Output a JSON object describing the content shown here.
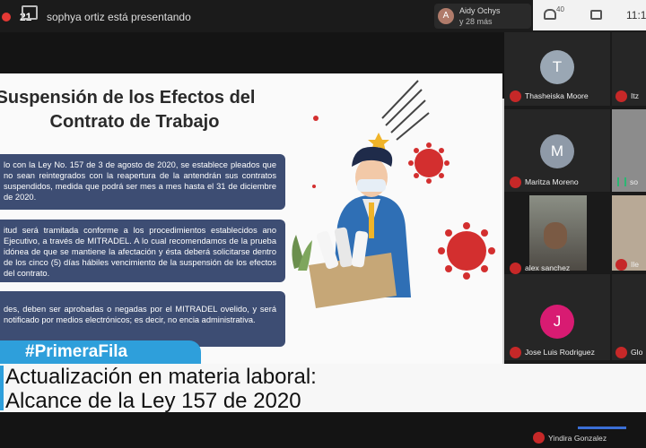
{
  "topbar": {
    "recording_count": "21",
    "presenting_text": "sophya ortiz está presentando",
    "presenter_chip": {
      "avatar_letter": "A",
      "name": "Aidy Ochys",
      "more": "y 28 más"
    },
    "people_count": "40",
    "clock": "11:1"
  },
  "slide": {
    "title_line1": "Suspensión de los Efectos del",
    "title_line2": "Contrato de Trabajo",
    "box1": "lo con la Ley No. 157 de 3 de agosto de 2020, se establece pleados que no sean reintegrados con la reapertura de la antendrán sus contratos suspendidos, medida que podrá ser mes a mes hasta el 31 de diciembre de 2020.",
    "box2": "itud será tramitada conforme a los procedimientos establecidos ano Ejecutivo, a través de MITRADEL. A lo cual recomendamos de la prueba idónea de que se mantiene la afectación y ésta deberá solicitarse dentro de los cinco (5) días hábiles vencimiento de la suspensión de los efectos del contrato.",
    "box3": "des, deben ser aprobadas o negadas por el MITRADEL ovelido, y será notificado por medios electrónicos; es decir, no encia administrativa."
  },
  "participants": [
    {
      "name": "Thasheiska Moore",
      "avatar_letter": "T",
      "avatar_color": "#9aa7b4"
    },
    {
      "name": "Itz",
      "avatar_letter": "",
      "avatar_color": ""
    },
    {
      "name": "Maritza Moreno",
      "avatar_letter": "M",
      "avatar_color": "#8f9aa8"
    },
    {
      "name": "so",
      "avatar_letter": "",
      "avatar_color": ""
    },
    {
      "name": "alex sanchez",
      "avatar_letter": "",
      "avatar_color": ""
    },
    {
      "name": "Ile",
      "avatar_letter": "",
      "avatar_color": ""
    },
    {
      "name": "Jose Luis Rodriguez",
      "avatar_letter": "J",
      "avatar_color": "#d81b72"
    },
    {
      "name": "Glo",
      "avatar_letter": "",
      "avatar_color": ""
    },
    {
      "name": "Yindira Gonzalez",
      "avatar_letter": "",
      "avatar_color": ""
    }
  ],
  "banner": {
    "hashtag": "#PrimeraFila",
    "line1": "Actualización en materia laboral:",
    "line2": "Alcance de la Ley 157 de 2020"
  },
  "colors": {
    "box_bg": "#3d4d73",
    "hashtag_bg": "#2e9fdb",
    "mic_off": "#c62828",
    "virus": "#d32f2f"
  }
}
